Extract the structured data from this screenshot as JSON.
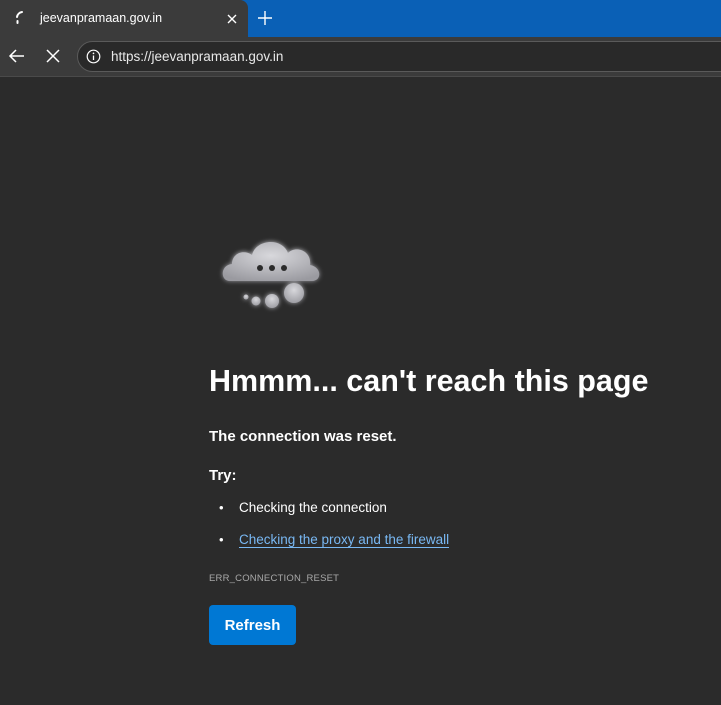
{
  "tab": {
    "title": "jeevanpramaan.gov.in",
    "status_icon": "loading-spinner-icon",
    "close_icon": "close-icon"
  },
  "toolbar": {
    "new_tab_icon": "plus-icon",
    "back_icon": "arrow-left-icon",
    "stop_icon": "close-icon",
    "site_info_icon": "info-icon",
    "url": "https://jeevanpramaan.gov.in"
  },
  "error": {
    "illustration": "cloud-icon",
    "heading": "Hmmm... can't reach this page",
    "message": "The connection was reset.",
    "try_label": "Try:",
    "suggestions": [
      {
        "text": "Checking the connection",
        "is_link": false
      },
      {
        "text": "Checking the proxy and the firewall",
        "is_link": true
      }
    ],
    "code": "ERR_CONNECTION_RESET",
    "refresh_label": "Refresh"
  },
  "colors": {
    "tabstrip_bg": "#0a60b6",
    "chrome_bg": "#3b3b3b",
    "page_bg": "#2b2b2b",
    "link": "#79b8f3",
    "button_bg": "#0078d4"
  }
}
